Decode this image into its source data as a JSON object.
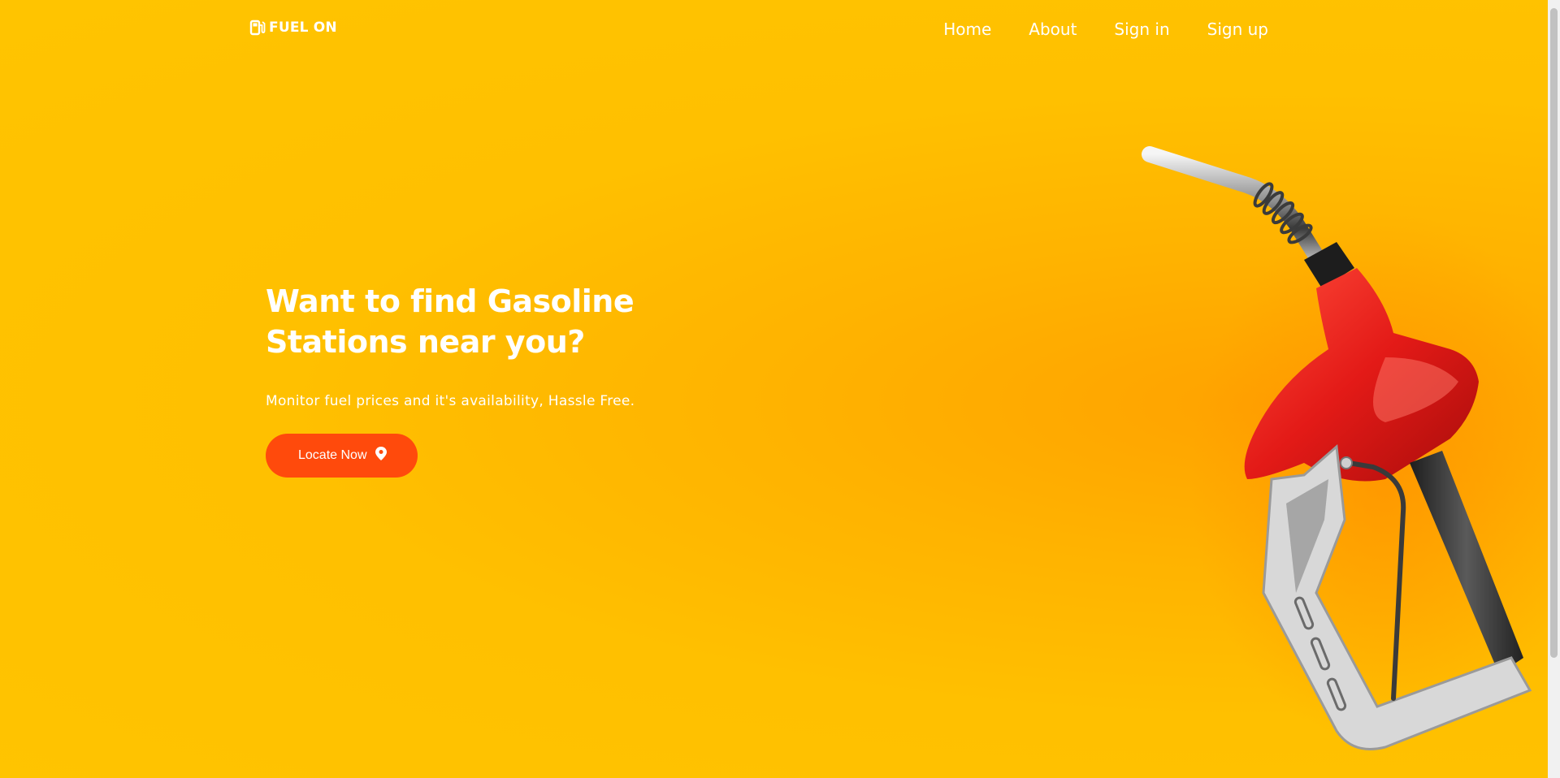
{
  "brand": {
    "name": "FUEL ON",
    "icon": "gas-pump-icon"
  },
  "nav": {
    "links": [
      {
        "label": "Home"
      },
      {
        "label": "About"
      },
      {
        "label": "Sign in"
      },
      {
        "label": "Sign up"
      }
    ]
  },
  "hero": {
    "title": "Want to find Gasoline Stations near you?",
    "subtitle": "Monitor fuel prices and it's availability, Hassle Free.",
    "cta_label": "Locate Now",
    "cta_icon": "map-pin-icon"
  },
  "colors": {
    "background": "#ffc400",
    "accent": "#ff4a0c",
    "nozzle": "#e8201c"
  }
}
